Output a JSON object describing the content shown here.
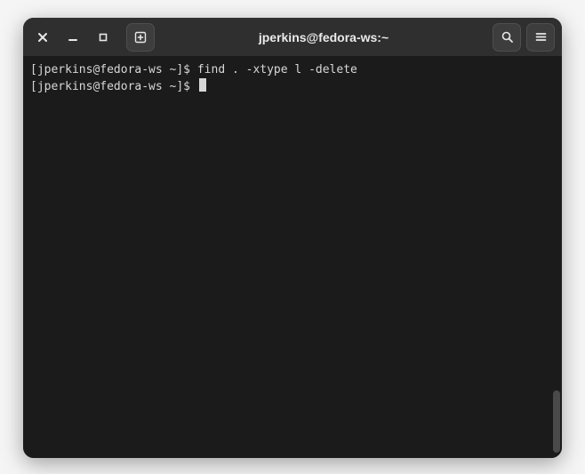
{
  "window": {
    "title": "jperkins@fedora-ws:~"
  },
  "terminal": {
    "lines": [
      {
        "prompt": "[jperkins@fedora-ws ~]$ ",
        "command": "find . -xtype l -delete"
      },
      {
        "prompt": "[jperkins@fedora-ws ~]$ ",
        "command": ""
      }
    ],
    "cursor_line": 1
  }
}
